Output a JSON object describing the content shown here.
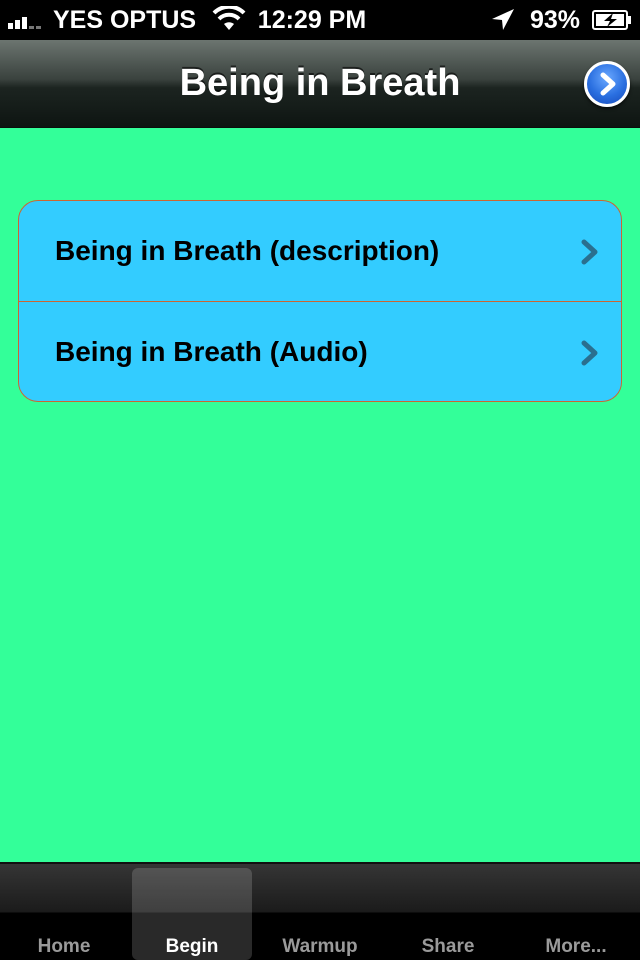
{
  "status_bar": {
    "carrier": "YES OPTUS",
    "time": "12:29 PM",
    "battery": "93%"
  },
  "nav": {
    "title": "Being in Breath",
    "button_icon": "chevron-right-circle-icon"
  },
  "table": {
    "rows": [
      {
        "label": "Being in Breath (description)"
      },
      {
        "label": "Being in Breath (Audio)"
      }
    ]
  },
  "tabs": [
    {
      "label": "Home",
      "selected": false
    },
    {
      "label": "Begin",
      "selected": true
    },
    {
      "label": "Warmup",
      "selected": false
    },
    {
      "label": "Share",
      "selected": false
    },
    {
      "label": "More...",
      "selected": false
    }
  ],
  "colors": {
    "background": "#33ff99",
    "table_fill": "#33ccff",
    "table_border": "#cc6633"
  }
}
